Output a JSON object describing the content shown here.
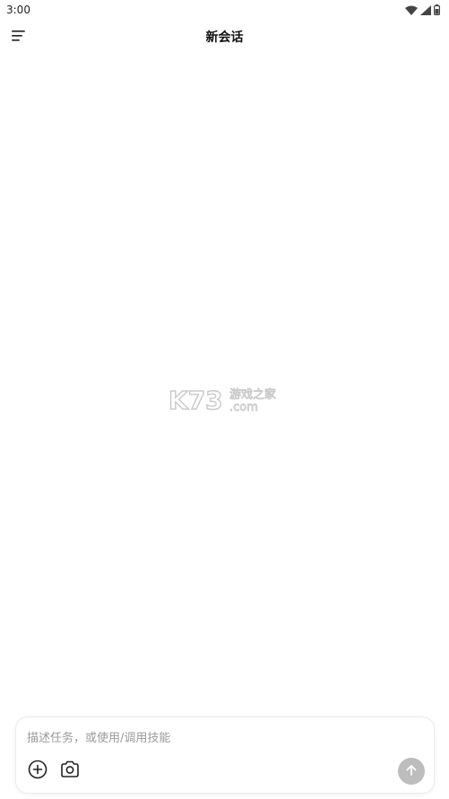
{
  "status_bar": {
    "time": "3:00",
    "icons": [
      "wifi-icon",
      "signal-icon",
      "battery-icon"
    ]
  },
  "header": {
    "menu_icon": "hamburger-menu-icon",
    "title": "新会话"
  },
  "watermark": {
    "brand": "K73",
    "tagline": "游戏之家",
    "domain": ".com"
  },
  "composer": {
    "placeholder": "描述任务，或使用/调用技能",
    "value": "",
    "actions": [
      {
        "name": "add-attachment-button",
        "icon": "plus-circle-icon"
      },
      {
        "name": "camera-button",
        "icon": "camera-icon"
      }
    ],
    "send_icon": "arrow-up-icon"
  },
  "colors": {
    "background": "#ffffff",
    "send_button": "#bdbdbd",
    "placeholder": "#9a9a9a"
  }
}
